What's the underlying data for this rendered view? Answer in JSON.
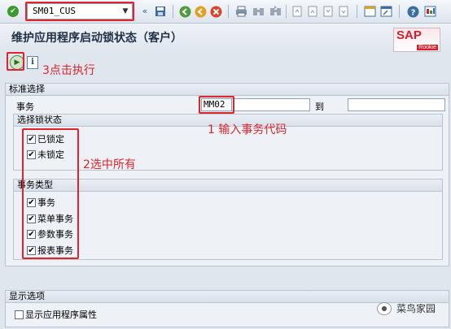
{
  "toolbar": {
    "command_value": "SM01_CUS",
    "icons": [
      "enter-icon",
      "back-nav-icon",
      "save-icon",
      "back-icon",
      "exit-icon",
      "cancel-icon",
      "print-icon",
      "find-icon",
      "find-next-icon",
      "first-page-icon",
      "prev-page-icon",
      "next-page-icon",
      "last-page-icon",
      "new-session-icon",
      "shortcut-icon",
      "help-icon",
      "customize-icon"
    ]
  },
  "title": "维护应用程序启动锁状态（客户）",
  "sap_logo": {
    "text": "SAP",
    "sub": "Rookie"
  },
  "app_toolbar": {
    "info": "i"
  },
  "annotations": {
    "step3": "3点击执行",
    "step1": "1 输入事务代码",
    "step2": "2选中所有"
  },
  "std_selection": {
    "title": "标准选择",
    "transaction_label": "事务",
    "transaction_value": "MM02",
    "to_label": "到",
    "to_value": "",
    "lock_status": {
      "title": "选择锁状态",
      "items": [
        {
          "label": "已锁定",
          "checked": "✔"
        },
        {
          "label": "未锁定",
          "checked": "✔"
        }
      ]
    },
    "tx_type": {
      "title": "事务类型",
      "items": [
        {
          "label": "事务",
          "checked": "✔"
        },
        {
          "label": "菜单事务",
          "checked": "✔"
        },
        {
          "label": "参数事务",
          "checked": "✔"
        },
        {
          "label": "报表事务",
          "checked": "✔"
        }
      ]
    }
  },
  "display_options": {
    "title": "显示选项",
    "show_app_attr_label": "显示应用程序属性",
    "show_app_attr_checked": ""
  },
  "watermark": "菜鸟家园"
}
